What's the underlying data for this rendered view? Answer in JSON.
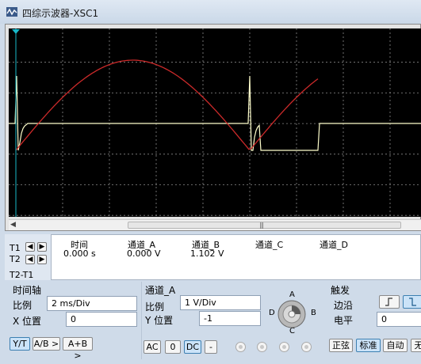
{
  "window": {
    "title": "四综示波器-XSC1"
  },
  "scope": {
    "grid_columns": 10,
    "grid_rows": 8,
    "trace_a_color": "#cc2a2a",
    "trace_b_color": "#ffffcc",
    "cursor_marker_color": "#18b8c8"
  },
  "measurement": {
    "t1_label": "T1",
    "t2_label": "T2",
    "t2t1_label": "T2-T1",
    "headers": [
      "时间",
      "通道_A",
      "通道_B",
      "通道_C",
      "通道_D"
    ],
    "t1_values": [
      "0.000 s",
      "0.000 V",
      "1.102 V",
      "",
      ""
    ]
  },
  "timebase": {
    "title": "时间轴",
    "scale_label": "比例",
    "scale_value": "2 ms/Div",
    "xpos_label": "X 位置",
    "xpos_value": "0",
    "buttons": [
      "Y/T",
      "A/B >",
      "A+B >"
    ]
  },
  "channel": {
    "title": "通道_A",
    "scale_label": "比例",
    "scale_value": "1  V/Div",
    "ypos_label": "Y 位置",
    "ypos_value": "-1",
    "coupling_buttons": [
      "AC",
      "0",
      "DC",
      "-"
    ],
    "knob_labels": {
      "a": "A",
      "b": "B",
      "c": "C",
      "d": "D"
    }
  },
  "trigger": {
    "title": "触发",
    "edge_label": "边沿",
    "level_label": "电平",
    "level_value": "0",
    "mode_buttons": [
      "正弦",
      "标准",
      "自动",
      "无"
    ]
  }
}
